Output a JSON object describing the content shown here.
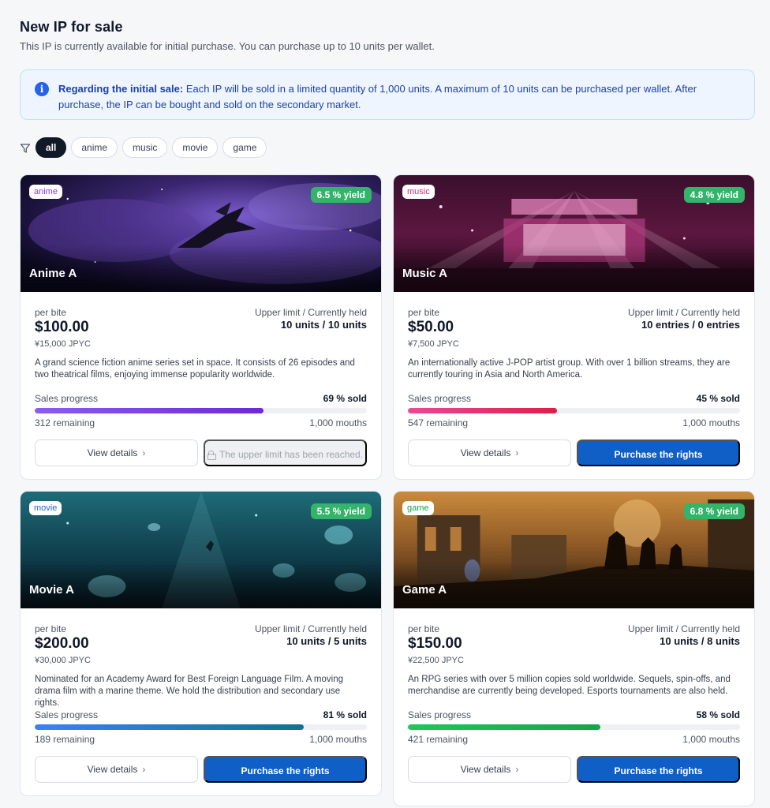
{
  "header": {
    "title": "New IP for sale",
    "subtitle": "This IP is currently available for initial purchase. You can purchase up to 10 units per wallet."
  },
  "notice": {
    "icon": "info-icon",
    "bold": "Regarding the initial sale:",
    "text": " Each IP will be sold in a limited quantity of 1,000 units. A maximum of 10 units can be purchased per wallet. After purchase, the IP can be bought and sold on the secondary market."
  },
  "filters": {
    "icon": "filter-icon",
    "chips": [
      "all",
      "anime",
      "music",
      "movie",
      "game"
    ],
    "active": "all"
  },
  "common": {
    "per_bite": "per bite",
    "limit_label": "Upper limit / Currently held",
    "sales_progress": "Sales progress",
    "view_details": "View details",
    "purchase": "Purchase the rights",
    "limit_reached": "The upper limit has been reached."
  },
  "cards": [
    {
      "category": "anime",
      "category_color": "#9333ea",
      "yield": "6.5 % yield",
      "name": "Anime A",
      "price": "$100.00",
      "jpyc": "¥15,000 JPYC",
      "limit": "10 units / 10 units",
      "desc": "A grand science fiction anime series set in space. It consists of 26 episodes and two theatrical films, enjoying immense popularity worldwide.",
      "sold_label": "69 % sold",
      "sold_fraction": 0.69,
      "remaining": "312 remaining",
      "total": "1,000 mouths",
      "bar_colors": [
        "#8b5cf6",
        "#6d28d9"
      ],
      "limit_reached": true
    },
    {
      "category": "music",
      "category_color": "#db2777",
      "yield": "4.8 % yield",
      "name": "Music A",
      "price": "$50.00",
      "jpyc": "¥7,500 JPYC",
      "limit": "10 entries / 0 entries",
      "desc": "An internationally active J-POP artist group. With over 1 billion streams, they are currently touring in Asia and North America.",
      "sold_label": "45 % sold",
      "sold_fraction": 0.45,
      "remaining": "547 remaining",
      "total": "1,000 mouths",
      "bar_colors": [
        "#ec4899",
        "#e11d48"
      ],
      "limit_reached": false
    },
    {
      "category": "movie",
      "category_color": "#2563eb",
      "yield": "5.5 % yield",
      "name": "Movie A",
      "price": "$200.00",
      "jpyc": "¥30,000 JPYC",
      "limit": "10 units / 5 units",
      "desc": "Nominated for an Academy Award for Best Foreign Language Film. A moving drama film with a marine theme. We hold the distribution and secondary use rights.",
      "sold_label": "81 % sold",
      "sold_fraction": 0.81,
      "remaining": "189 remaining",
      "total": "1,000 mouths",
      "bar_colors": [
        "#3b82f6",
        "#0e7490"
      ],
      "limit_reached": false
    },
    {
      "category": "game",
      "category_color": "#16a34a",
      "yield": "6.8 % yield",
      "name": "Game A",
      "price": "$150.00",
      "jpyc": "¥22,500 JPYC",
      "limit": "10 units / 8 units",
      "desc": "An RPG series with over 5 million copies sold worldwide. Sequels, spin-offs, and merchandise are currently being developed. Esports tournaments are also held.",
      "sold_label": "58 % sold",
      "sold_fraction": 0.58,
      "remaining": "421 remaining",
      "total": "1,000 mouths",
      "bar_colors": [
        "#22c55e",
        "#16a34a"
      ],
      "limit_reached": false
    }
  ]
}
